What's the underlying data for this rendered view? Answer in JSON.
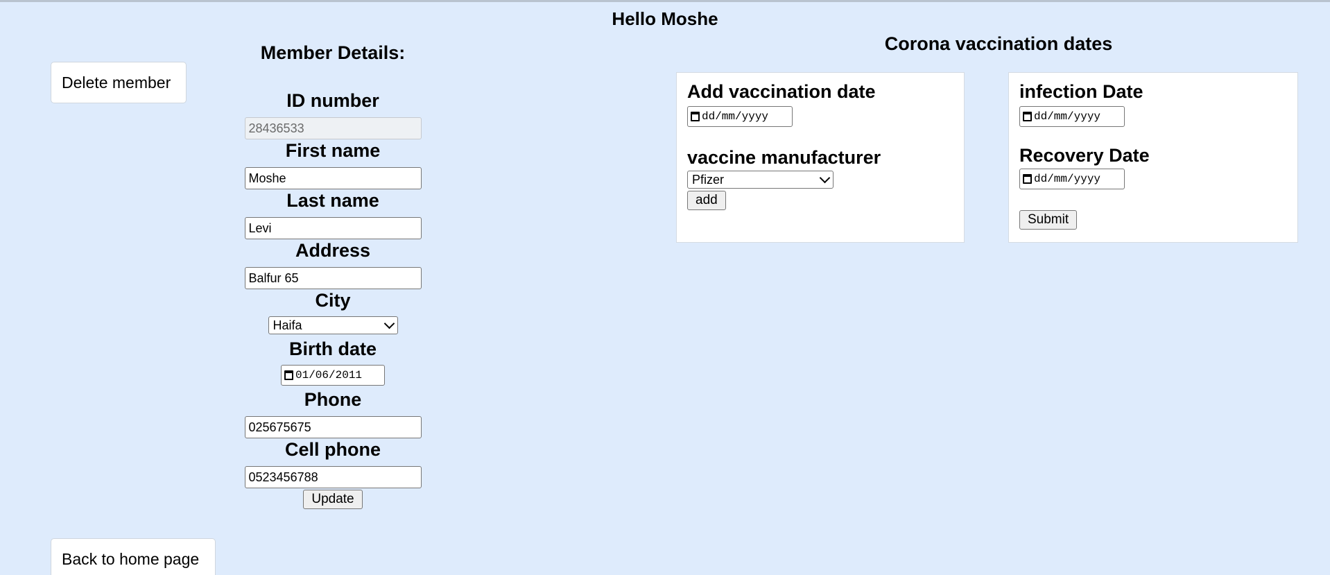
{
  "greeting": "Hello Moshe",
  "buttons": {
    "delete_member": "Delete member",
    "back_home": "Back to home page",
    "update": "Update",
    "add": "add",
    "submit": "Submit"
  },
  "member": {
    "title": "Member Details:",
    "fields": {
      "id_label": "ID number",
      "id_value": "28436533",
      "first_name_label": "First name",
      "first_name_value": "Moshe",
      "last_name_label": "Last name",
      "last_name_value": "Levi",
      "address_label": "Address",
      "address_value": "Balfur 65",
      "city_label": "City",
      "city_value": "Haifa",
      "birth_label": "Birth date",
      "birth_value": "01/06/2011",
      "phone_label": "Phone",
      "phone_value": "025675675",
      "cell_label": "Cell phone",
      "cell_value": "0523456788"
    }
  },
  "vaccination": {
    "title": "Corona vaccination dates",
    "add_date_label": "Add vaccination date",
    "date_placeholder": "dd/mm/yyyy",
    "manufacturer_label": "vaccine manufacturer",
    "manufacturer_value": "Pfizer",
    "infection_label": "infection Date",
    "recovery_label": "Recovery Date"
  },
  "icons": {
    "calendar": "calendar-icon",
    "chevron": "chevron-down-icon"
  }
}
